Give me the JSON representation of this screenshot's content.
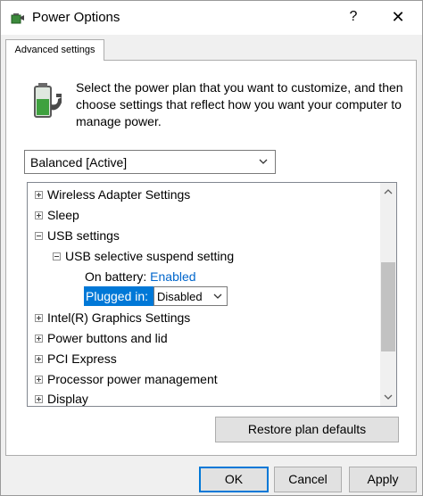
{
  "window": {
    "title": "Power Options",
    "help_glyph": "?",
    "close_glyph": "✕"
  },
  "tab": {
    "label": "Advanced settings"
  },
  "description": "Select the power plan that you want to customize, and then choose settings that reflect how you want your computer to manage power.",
  "plan_select": {
    "value": "Balanced [Active]"
  },
  "tree": {
    "items": [
      {
        "label": "Wireless Adapter Settings",
        "expander": "plus"
      },
      {
        "label": "Sleep",
        "expander": "plus"
      },
      {
        "label": "USB settings",
        "expander": "minus"
      },
      {
        "label": "USB selective suspend setting",
        "expander": "minus"
      },
      {
        "label": "On battery:",
        "value": "Enabled"
      },
      {
        "label": "Plugged in:",
        "value": "Disabled"
      },
      {
        "label": "Intel(R) Graphics Settings",
        "expander": "plus"
      },
      {
        "label": "Power buttons and lid",
        "expander": "plus"
      },
      {
        "label": "PCI Express",
        "expander": "plus"
      },
      {
        "label": "Processor power management",
        "expander": "plus"
      },
      {
        "label": "Display",
        "expander": "plus"
      }
    ]
  },
  "buttons": {
    "restore": "Restore plan defaults",
    "ok": "OK",
    "cancel": "Cancel",
    "apply": "Apply"
  },
  "colors": {
    "accent": "#0078d7",
    "link": "#0066cc",
    "window_bg": "#f0f0f0"
  },
  "icons": {
    "app": "power-options-icon",
    "plan": "battery-plug-icon"
  }
}
